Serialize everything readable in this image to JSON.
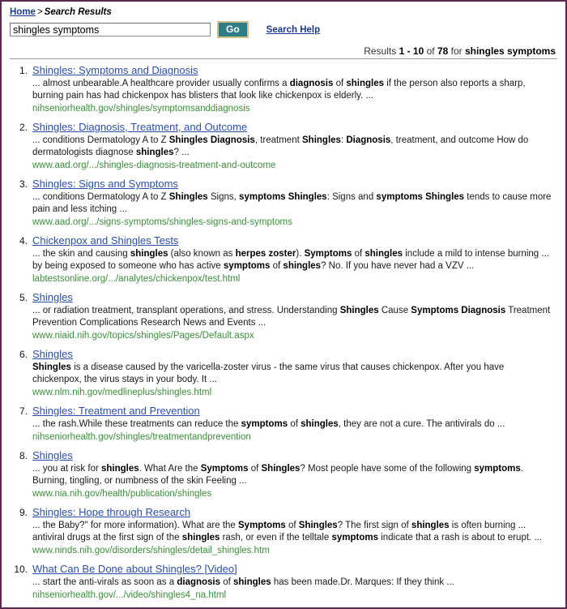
{
  "colors": {
    "page_border": "#5b2a52",
    "link_blue": "#2b4fa8",
    "url_green": "#3a8f3a",
    "go_button_bg": "#2e7c85",
    "go_button_border": "#cfc08a"
  },
  "breadcrumb": {
    "home_label": "Home",
    "separator": ">",
    "current": "Search Results"
  },
  "search": {
    "query_value": "shingles symptoms",
    "placeholder": "",
    "go_label": "Go",
    "help_label": "Search Help"
  },
  "summary": {
    "prefix": "Results ",
    "range": "1 - 10",
    "middle": " of ",
    "total": "78",
    "for_text": " for ",
    "query": "shingles symptoms"
  },
  "results": [
    {
      "rank": "1.",
      "title": "Shingles: Symptoms and Diagnosis",
      "snippet_html": "... almost unbearable.A healthcare provider usually confirms a <b>diagnosis</b> of <b>shingles</b> if the person also reports a sharp, burning pain has had chickenpox has blisters that look like chickenpox is elderly. ...",
      "url": "nihseniorhealth.gov/shingles/symptomsanddiagnosis"
    },
    {
      "rank": "2.",
      "title": "Shingles: Diagnosis, Treatment, and Outcome",
      "snippet_html": "... conditions Dermatology A to Z <b>Shingles Diagnosis</b>, treatment <b>Shingles</b>: <b>Diagnosis</b>, treatment, and outcome How do dermatologists diagnose <b>shingles</b>? ...",
      "url": "www.aad.org/.../shingles-diagnosis-treatment-and-outcome"
    },
    {
      "rank": "3.",
      "title": "Shingles: Signs and Symptoms",
      "snippet_html": "... conditions Dermatology A to Z <b>Shingles</b> Signs, <b>symptoms Shingles</b>: Signs and <b>symptoms Shingles</b> tends to cause more pain and less itching ...",
      "url": "www.aad.org/.../signs-symptoms/shingles-signs-and-symptoms"
    },
    {
      "rank": "4.",
      "title": "Chickenpox and Shingles Tests",
      "snippet_html": "... the skin and causing <b>shingles</b> (also known as <b>herpes zoster</b>). <b>Symptoms</b> of <b>shingles</b> include a mild to intense burning ... by being exposed to someone who has active <b>symptoms</b> of <b>shingles</b>? No. If you have never had a VZV ...",
      "url": "labtestsonline.org/.../analytes/chickenpox/test.html"
    },
    {
      "rank": "5.",
      "title": "Shingles",
      "snippet_html": "... or radiation treatment, transplant operations, and stress. Understanding <b>Shingles</b> Cause <b>Symptoms Diagnosis</b> Treatment Prevention Complications Research News and Events ...",
      "url": "www.niaid.nih.gov/topics/shingles/Pages/Default.aspx"
    },
    {
      "rank": "6.",
      "title": "Shingles",
      "snippet_html": "<b>Shingles</b> is a disease caused by the varicella-zoster virus - the same virus that causes chickenpox. After you have chickenpox, the virus stays in your body. It ...",
      "url": "www.nlm.nih.gov/medlineplus/shingles.html"
    },
    {
      "rank": "7.",
      "title": "Shingles: Treatment and Prevention",
      "snippet_html": "... the rash.While these treatments can reduce the <b>symptoms</b> of <b>shingles</b>, they are not a cure. The antivirals do ...",
      "url": "nihseniorhealth.gov/shingles/treatmentandprevention"
    },
    {
      "rank": "8.",
      "title": "Shingles",
      "snippet_html": "... you at risk for <b>shingles</b>. What Are the <b>Symptoms</b> of <b>Shingles</b>? Most people have some of the following <b>symptoms</b>. Burning, tingling, or numbness of the skin Feeling ...",
      "url": "www.nia.nih.gov/health/publication/shingles"
    },
    {
      "rank": "9.",
      "title": "Shingles: Hope through Research",
      "snippet_html": "... the Baby?\" for more information). What are the <b>Symptoms</b> of <b>Shingles</b>? The first sign of <b>shingles</b> is often burning ... antiviral drugs at the first sign of the <b>shingles</b> rash, or even if the telltale <b>symptoms</b> indicate that a rash is about to erupt. ...",
      "url": "www.ninds.nih.gov/disorders/shingles/detail_shingles.htm"
    },
    {
      "rank": "10.",
      "title": "What Can Be Done about Shingles? [Video]",
      "snippet_html": "... start the anti-virals as soon as a <b>diagnosis</b> of <b>shingles</b> has been made.Dr. Marques: If they think ...",
      "url": "nihseniorhealth.gov/.../video/shingles4_na.html"
    }
  ]
}
